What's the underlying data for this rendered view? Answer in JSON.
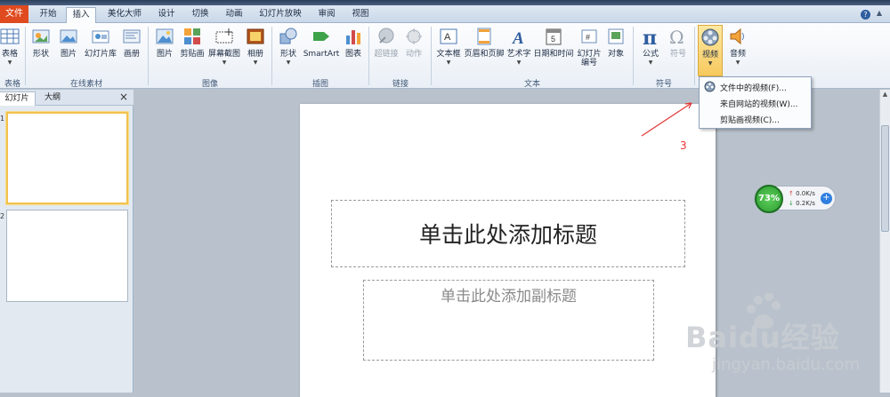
{
  "tabs": {
    "file": "文件",
    "items": [
      "开始",
      "插入",
      "美化大师",
      "设计",
      "切换",
      "动画",
      "幻灯片放映",
      "审阅",
      "视图"
    ],
    "active": "插入"
  },
  "ribbon": {
    "buttons": [
      {
        "label": "表格",
        "icon": "table-icon",
        "dropdown": true
      },
      {
        "label": "形状",
        "icon": "shapes-icon"
      },
      {
        "label": "图片",
        "icon": "picture-icon"
      },
      {
        "label": "幻灯片库",
        "icon": "slide-library-icon"
      },
      {
        "label": "画册",
        "icon": "album-icon"
      },
      {
        "label": "图片",
        "icon": "picture-icon"
      },
      {
        "label": "剪贴画",
        "icon": "clipart-icon"
      },
      {
        "label": "屏幕截图",
        "icon": "screenshot-icon",
        "dropdown": true
      },
      {
        "label": "相册",
        "icon": "photo-album-icon",
        "dropdown": true
      },
      {
        "label": "形状",
        "icon": "shapes-icon",
        "dropdown": true
      },
      {
        "label": "SmartArt",
        "icon": "smartart-icon"
      },
      {
        "label": "图表",
        "icon": "chart-icon"
      },
      {
        "label": "超链接",
        "icon": "hyperlink-icon",
        "disabled": true
      },
      {
        "label": "动作",
        "icon": "action-icon",
        "disabled": true
      },
      {
        "label": "文本框",
        "icon": "textbox-icon",
        "dropdown": true
      },
      {
        "label": "页眉和页脚",
        "icon": "header-footer-icon"
      },
      {
        "label": "艺术字",
        "icon": "wordart-icon",
        "dropdown": true
      },
      {
        "label": "日期和时间",
        "icon": "datetime-icon"
      },
      {
        "label": "幻灯片\n编号",
        "icon": "slide-number-icon"
      },
      {
        "label": "对象",
        "icon": "object-icon"
      },
      {
        "label": "公式",
        "icon": "equation-icon",
        "dropdown": true
      },
      {
        "label": "符号",
        "icon": "symbol-icon",
        "disabled": true
      },
      {
        "label": "视频",
        "icon": "video-icon",
        "dropdown": true,
        "highlighted": true
      },
      {
        "label": "音频",
        "icon": "audio-icon",
        "dropdown": true
      }
    ],
    "groups": [
      "表格",
      "在线素材",
      "图像",
      "插图",
      "链接",
      "文本",
      "符号"
    ]
  },
  "pane": {
    "tab_slides": "幻灯片",
    "tab_outline": "大纲",
    "close": "×",
    "thumbs": [
      "1",
      "2"
    ]
  },
  "slide": {
    "title_placeholder": "单击此处添加标题",
    "subtitle_placeholder": "单击此处添加副标题"
  },
  "video_menu": {
    "items": [
      "文件中的视频(F)...",
      "来自网站的视频(W)...",
      "剪贴画视频(C)..."
    ]
  },
  "annotation": {
    "step": "3",
    "color": "#e33333"
  },
  "netmon": {
    "percent": "73%",
    "up": "0.0K/s",
    "down": "0.2K/s"
  },
  "watermark": {
    "text": "Baidu经验",
    "url": "jingyan.baidu.com"
  },
  "colors": {
    "file_tab": "#e04a1f",
    "highlight": "#f7c95d",
    "selection": "#f2c24f"
  }
}
